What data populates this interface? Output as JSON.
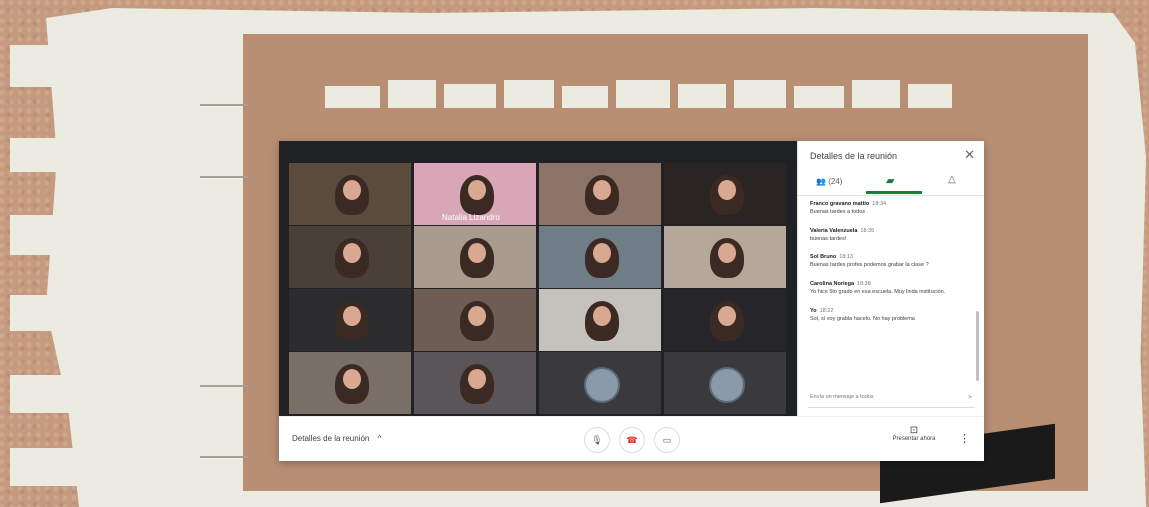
{
  "meeting": {
    "tiles": [
      {
        "bg": "#5b4b3d",
        "name": ""
      },
      {
        "bg": "#d8a6b6",
        "name": "Natalia Lizandro"
      },
      {
        "bg": "#8d7466",
        "name": ""
      },
      {
        "bg": "#2a2523",
        "name": ""
      },
      {
        "bg": "#4a4038",
        "name": ""
      },
      {
        "bg": "#a99c8f",
        "name": ""
      },
      {
        "bg": "#6f7d86",
        "name": ""
      },
      {
        "bg": "#b5a79a",
        "name": ""
      },
      {
        "bg": "#2c2c2e",
        "name": ""
      },
      {
        "bg": "#6d5d52",
        "name": ""
      },
      {
        "bg": "#c5c1bd",
        "name": ""
      },
      {
        "bg": "#26262a",
        "name": ""
      },
      {
        "bg": "#7a6f66",
        "name": ""
      },
      {
        "bg": "#5a5558",
        "name": ""
      },
      {
        "bg": "#3a3a3d",
        "name": "",
        "avatar": true
      },
      {
        "bg": "#3a3a3d",
        "name": "",
        "avatar": true
      }
    ]
  },
  "sidebar": {
    "title": "Detalles de la reunión",
    "close_icon": "close-icon",
    "people_tab": "(24)",
    "chat_icon": "chat-icon",
    "activities_icon": "activities-icon",
    "accent": "#188038",
    "messages": [
      {
        "who": "Franco gravano mattio",
        "time": "18:34",
        "text": "Buenas tardes a todos"
      },
      {
        "who": "Valeria Valenzuela",
        "time": "18:35",
        "text": "buenas tardes!"
      },
      {
        "who": "Sol Bruno",
        "time": "18:13",
        "text": "Buenas tardes profes podemos grabar la clase ?"
      },
      {
        "who": "Carolina Noriega",
        "time": "18:38",
        "text": "Yo hice 5to grado en esa escuela. Muy linda institución."
      },
      {
        "who": "Yo",
        "time": "18:22",
        "text": "Sol, sí voy grabla hacelo. No hay problema"
      }
    ],
    "compose_placeholder": "Envía un mensaje a todos"
  },
  "controls": {
    "details_label": "Detalles de la reunión",
    "chevron": "^",
    "mic_icon": "microphone-icon",
    "hangup_icon": "hang-up-icon",
    "camera_icon": "camera-icon",
    "present_label": "Presentar ahora",
    "more_icon": "more-options-icon"
  }
}
